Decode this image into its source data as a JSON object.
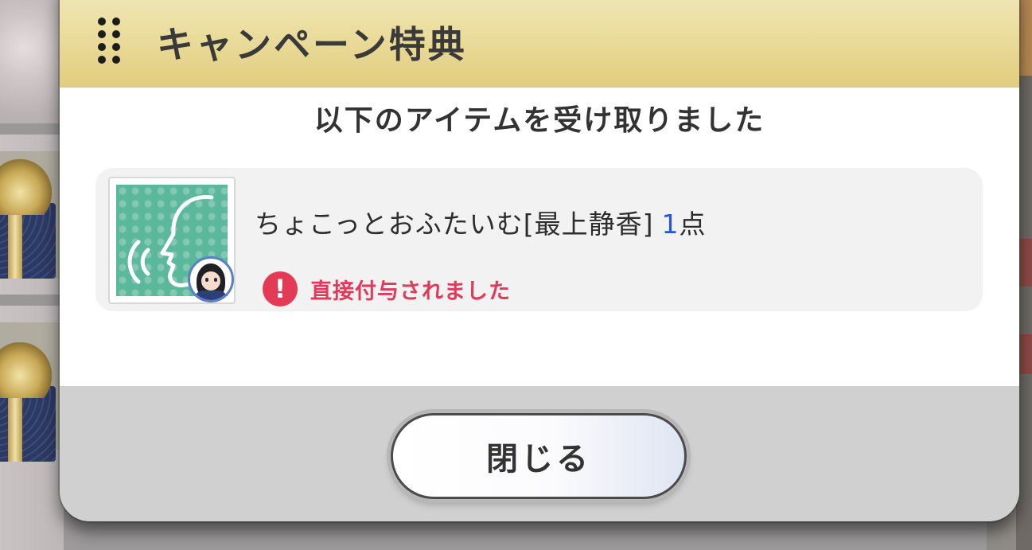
{
  "dialog": {
    "title": "キャンペーン特典",
    "message": "以下のアイテムを受け取りました",
    "item": {
      "name": "ちょこっとおふたいむ[最上静香]",
      "quantity": "1",
      "unit": "点",
      "icon": "voice-item-icon",
      "notice_icon": "!",
      "notice": "直接付与されました"
    },
    "close_button": "閉じる"
  },
  "colors": {
    "header_gold": "#e1cd7e",
    "quantity_blue": "#2a56d8",
    "notice_red": "#df3b5a",
    "item_icon_green": "#5cb89a"
  }
}
